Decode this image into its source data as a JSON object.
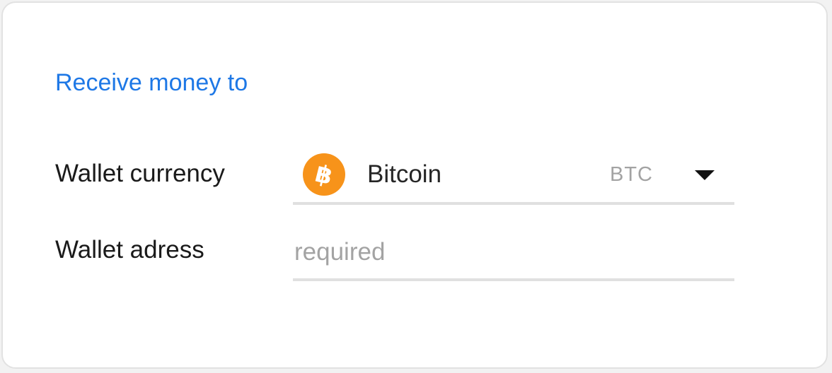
{
  "section": {
    "title": "Receive money to"
  },
  "wallet_currency": {
    "label": "Wallet currency",
    "selected_name": "Bitcoin",
    "selected_code": "BTC",
    "icon": "bitcoin-icon",
    "icon_color": "#f7931a",
    "dropdown_icon": "caret-down-icon"
  },
  "wallet_address": {
    "label": "Wallet adress",
    "value": "",
    "placeholder": "required"
  },
  "colors": {
    "accent": "#1e78e6",
    "border": "#e2e2e2",
    "underline": "#e0e0e0"
  }
}
